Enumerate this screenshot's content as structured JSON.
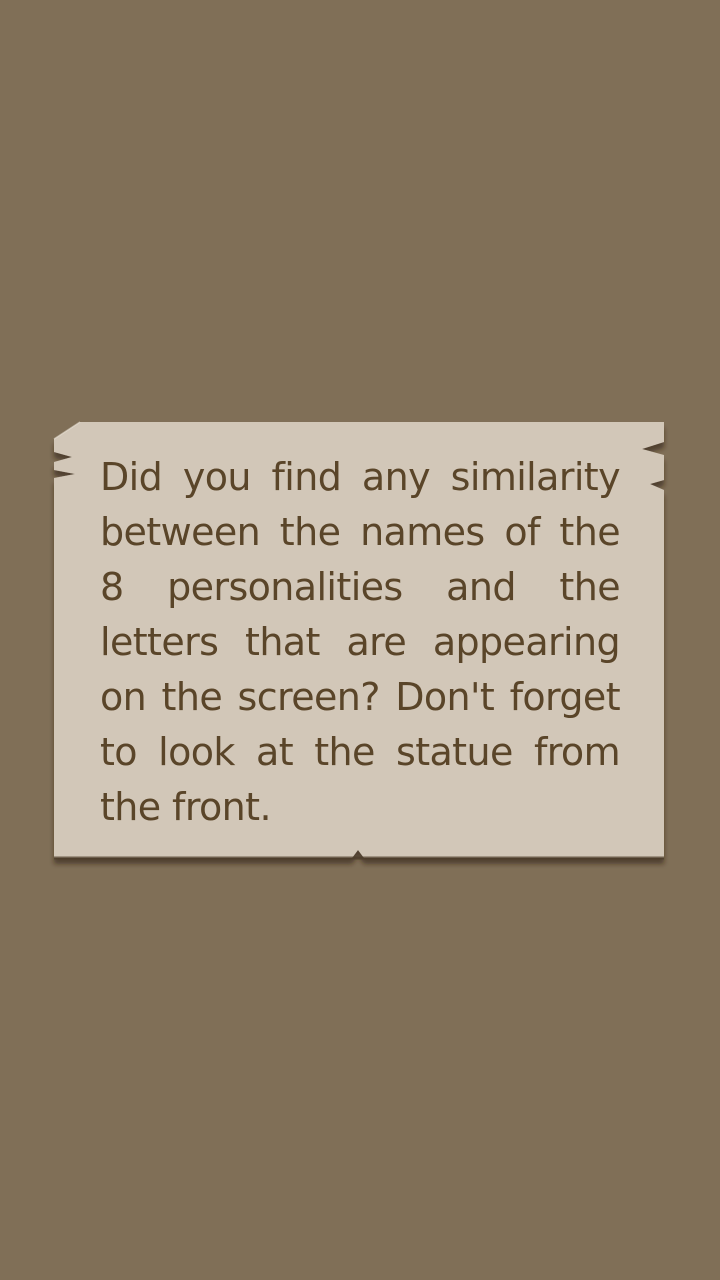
{
  "message": {
    "text": "Did you find any similarity between the names of the 8 personalities and the letters that are appearing on the screen? Don't forget to look at the statue from the front."
  },
  "colors": {
    "background": "#806f57",
    "note_paper": "#d2c7b8",
    "note_edge": "#4c3c29",
    "text": "#5a4529"
  }
}
